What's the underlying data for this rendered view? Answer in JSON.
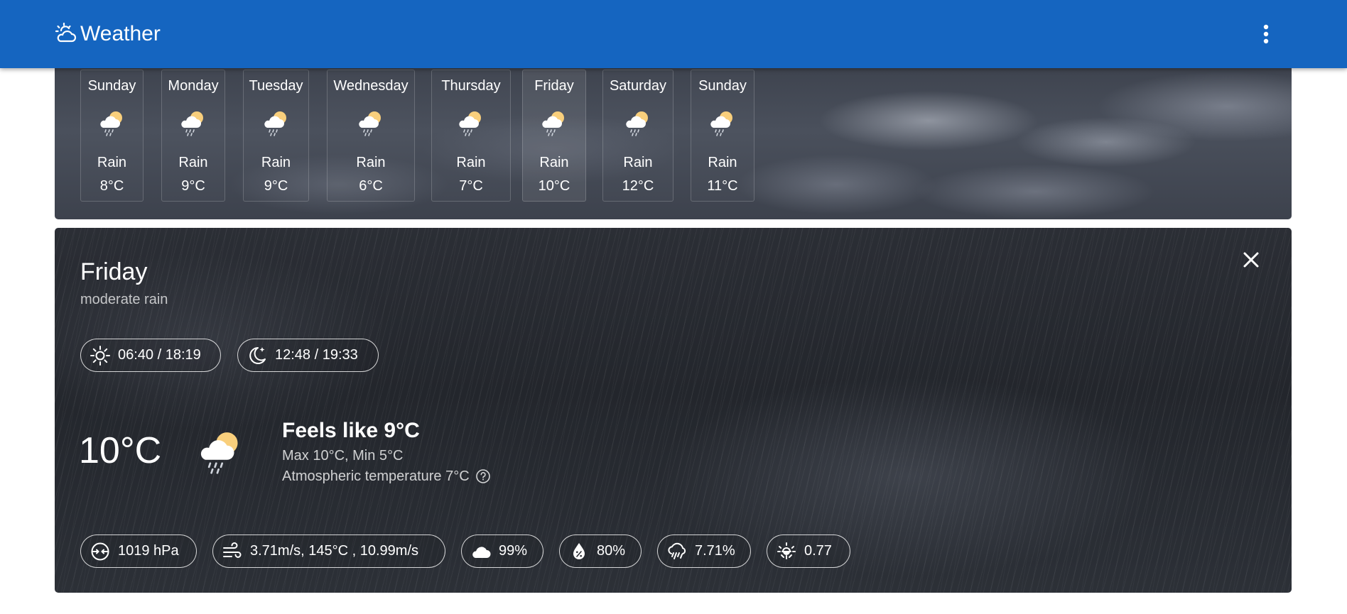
{
  "appbar": {
    "title": "Weather",
    "logo_icon": "weather-app-icon",
    "menu_icon": "more-vert-icon",
    "color": "#1565c0"
  },
  "forecast": {
    "days": [
      {
        "name": "Sunday",
        "condition": "Rain",
        "temp": "8°C",
        "icon": "rain-sun-icon"
      },
      {
        "name": "Monday",
        "condition": "Rain",
        "temp": "9°C",
        "icon": "rain-sun-icon"
      },
      {
        "name": "Tuesday",
        "condition": "Rain",
        "temp": "9°C",
        "icon": "rain-sun-icon"
      },
      {
        "name": "Wednesday",
        "condition": "Rain",
        "temp": "6°C",
        "icon": "rain-sun-icon"
      },
      {
        "name": "Thursday",
        "condition": "Rain",
        "temp": "7°C",
        "icon": "rain-sun-icon"
      },
      {
        "name": "Friday",
        "condition": "Rain",
        "temp": "10°C",
        "icon": "rain-sun-icon",
        "selected": true
      },
      {
        "name": "Saturday",
        "condition": "Rain",
        "temp": "12°C",
        "icon": "rain-sun-icon"
      },
      {
        "name": "Sunday",
        "condition": "Rain",
        "temp": "11°C",
        "icon": "rain-sun-icon"
      }
    ]
  },
  "detail": {
    "day": "Friday",
    "description": "moderate rain",
    "sun": "06:40 / 18:19",
    "moon": "12:48 / 19:33",
    "temperature": "10°C",
    "feels_like": "Feels like 9°C",
    "max_min": "Max 10°C, Min 5°C",
    "atmospheric": "Atmospheric temperature 7°C",
    "stats": {
      "pressure": "1019 hPa",
      "wind": "3.71m/s, 145°C , 10.99m/s",
      "clouds": "99%",
      "humidity": "80%",
      "precipitation": "7.71%",
      "uv": "0.77"
    }
  }
}
